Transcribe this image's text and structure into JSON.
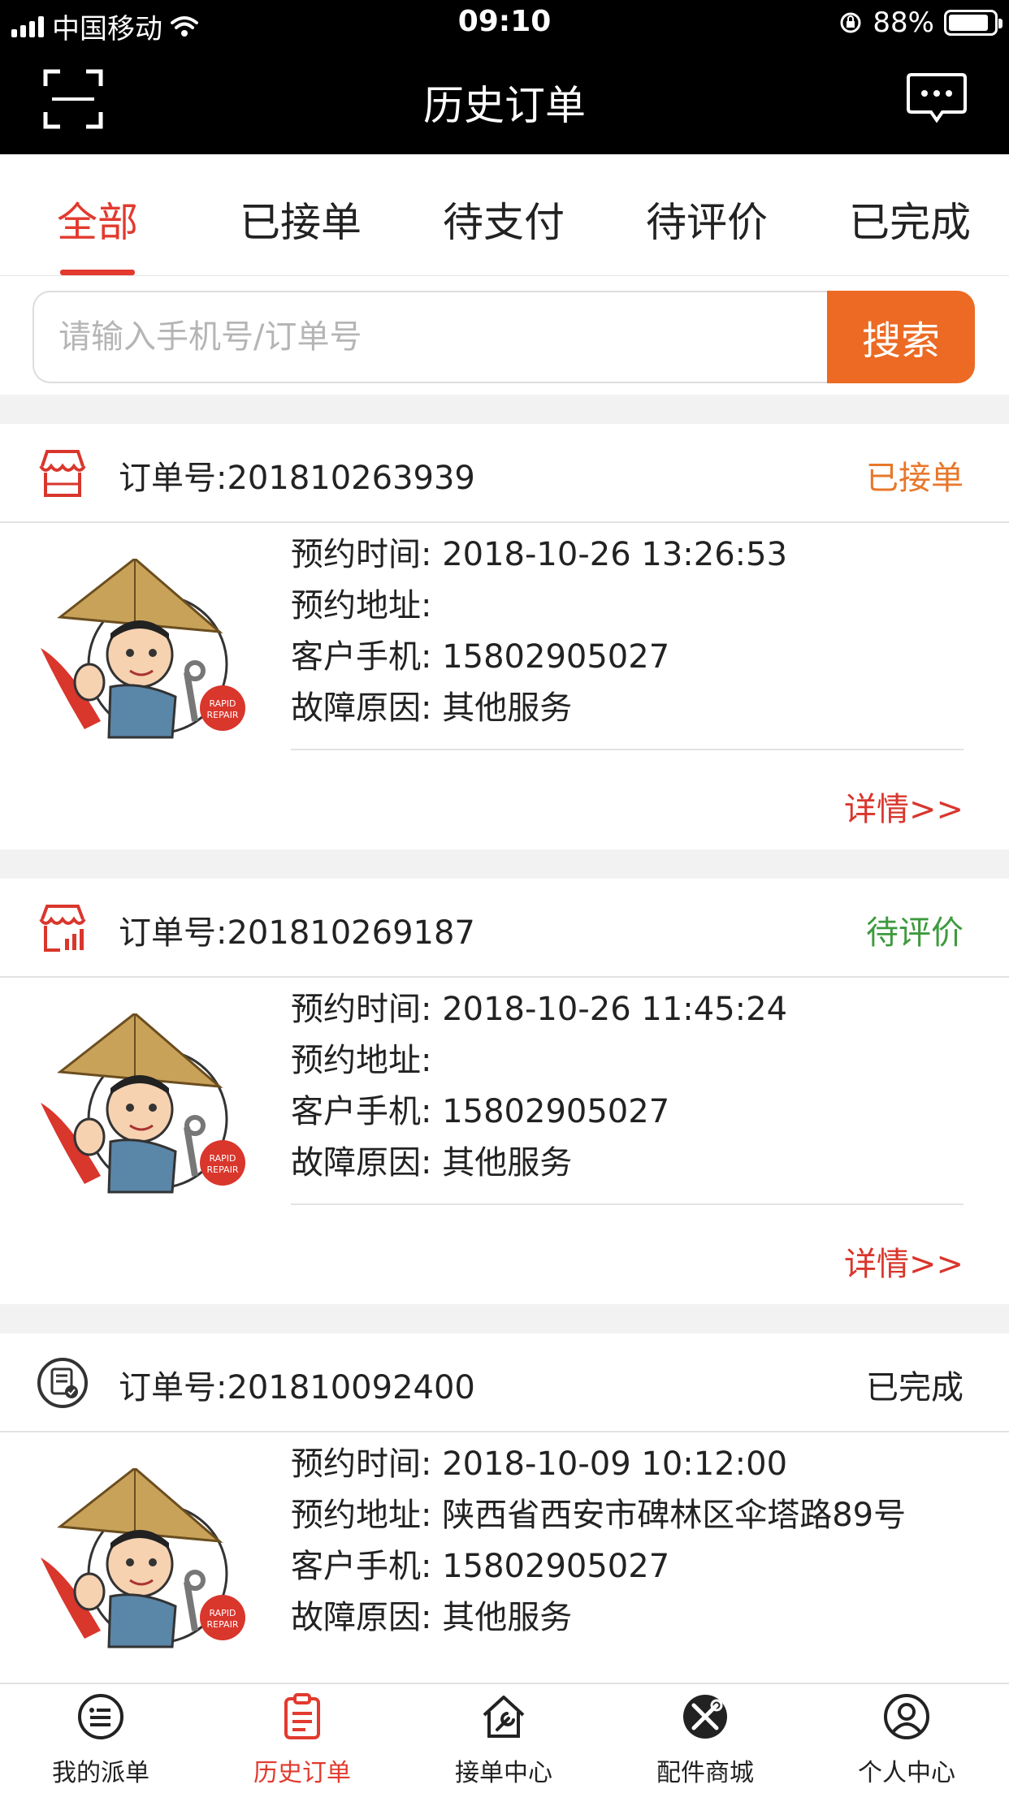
{
  "status_bar": {
    "carrier": "中国移动",
    "time": "09:10",
    "battery_text": "88%",
    "battery_level": 0.88
  },
  "header": {
    "title": "历史订单"
  },
  "tabs": [
    {
      "label": "全部",
      "active": true
    },
    {
      "label": "已接单",
      "active": false
    },
    {
      "label": "待支付",
      "active": false
    },
    {
      "label": "待评价",
      "active": false
    },
    {
      "label": "已完成",
      "active": false
    }
  ],
  "search": {
    "placeholder": "请输入手机号/订单号",
    "button_label": "搜索"
  },
  "orders": [
    {
      "order_label": "订单号:",
      "order_no": "201810263939",
      "status": "已接单",
      "status_color": "#e8772a",
      "icon": "storefront-icon",
      "time_label": "预约时间:",
      "time": "2018-10-26 13:26:53",
      "addr_label": "预约地址:",
      "addr": "",
      "phone_label": "客户手机:",
      "phone": "15802905027",
      "reason_label": "故障原因:",
      "reason": "其他服务",
      "detail_label": "详情>>"
    },
    {
      "order_label": "订单号:",
      "order_no": "201810269187",
      "status": "待评价",
      "status_color": "#3e9a3e",
      "icon": "shop-chart-icon",
      "time_label": "预约时间:",
      "time": "2018-10-26 11:45:24",
      "addr_label": "预约地址:",
      "addr": "",
      "phone_label": "客户手机:",
      "phone": "15802905027",
      "reason_label": "故障原因:",
      "reason": "其他服务",
      "detail_label": "详情>>"
    },
    {
      "order_label": "订单号:",
      "order_no": "201810092400",
      "status": "已完成",
      "status_color": "#222222",
      "icon": "document-check-icon",
      "time_label": "预约时间:",
      "time": "2018-10-09 10:12:00",
      "addr_label": "预约地址:",
      "addr": "陕西省西安市碑林区伞塔路89号",
      "phone_label": "客户手机:",
      "phone": "15802905027",
      "reason_label": "故障原因:",
      "reason": "其他服务"
    }
  ],
  "bottom_nav": [
    {
      "label": "我的派单",
      "icon": "list-circle-icon",
      "active": false
    },
    {
      "label": "历史订单",
      "icon": "clipboard-icon",
      "active": true
    },
    {
      "label": "接单中心",
      "icon": "house-wrench-icon",
      "active": false
    },
    {
      "label": "配件商城",
      "icon": "tools-circle-icon",
      "active": false
    },
    {
      "label": "个人中心",
      "icon": "user-circle-icon",
      "active": false
    }
  ],
  "colors": {
    "accent_red": "#e23a2e",
    "search_orange": "#ec6a23",
    "header_bg": "#000000"
  }
}
